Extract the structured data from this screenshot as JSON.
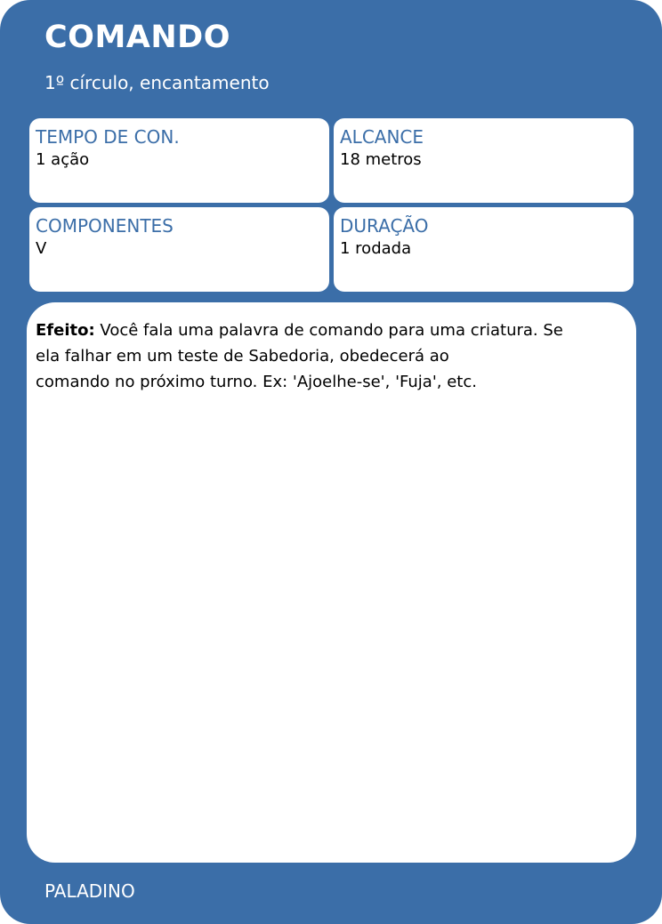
{
  "card": {
    "title": "COMANDO",
    "subtitle": "1º círculo, encantamento",
    "stats": {
      "casting_time": {
        "label": "TEMPO DE CON.",
        "value": "1 ação"
      },
      "range": {
        "label": "ALCANCE",
        "value": "18 metros"
      },
      "components": {
        "label": "COMPONENTES",
        "value": "V"
      },
      "duration": {
        "label": "DURAÇÃO",
        "value": "1 rodada"
      }
    },
    "effect": {
      "label": "Efeito:",
      "lines": [
        " Você fala uma palavra de comando para uma criatura. Se",
        "ela falhar em um teste de Sabedoria, obedecerá ao",
        "comando no próximo turno. Ex: 'Ajoelhe-se', 'Fuja', etc."
      ]
    },
    "footer": "PALADINO",
    "colors": {
      "background": "#3b6ea8",
      "panel": "#ffffff",
      "label_text": "#3b6ea8"
    }
  }
}
